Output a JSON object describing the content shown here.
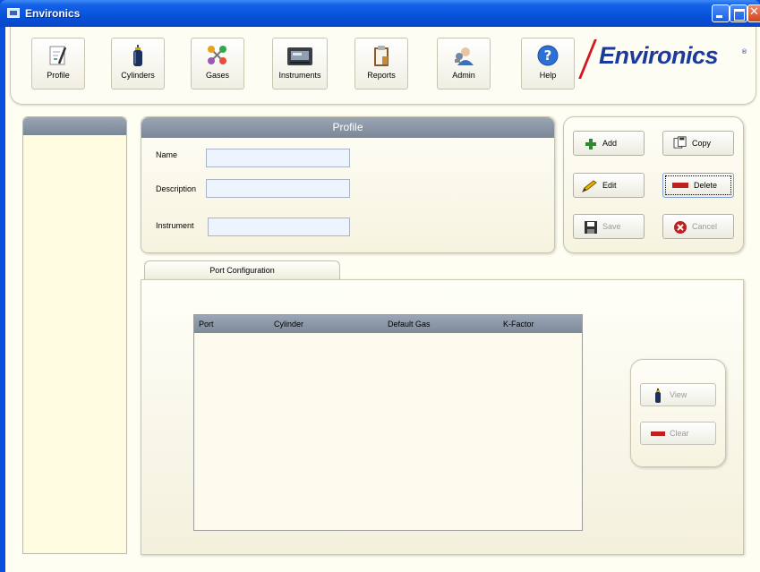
{
  "window": {
    "title": "Environics"
  },
  "toolbar": {
    "buttons": [
      {
        "label": "Profile",
        "icon": "profile-icon"
      },
      {
        "label": "Cylinders",
        "icon": "cylinder-icon"
      },
      {
        "label": "Gases",
        "icon": "gases-icon"
      },
      {
        "label": "Instruments",
        "icon": "instrument-icon"
      },
      {
        "label": "Reports",
        "icon": "reports-icon"
      },
      {
        "label": "Admin",
        "icon": "admin-icon"
      },
      {
        "label": "Help",
        "icon": "help-icon"
      }
    ],
    "logo_text": "Environics",
    "logo_mark": "®"
  },
  "profile": {
    "header": "Profile",
    "fields": {
      "name_label": "Name",
      "name_value": "",
      "description_label": "Description",
      "description_value": "",
      "instrument_label": "Instrument",
      "instrument_value": ""
    }
  },
  "actions": {
    "add": "Add",
    "copy": "Copy",
    "edit": "Edit",
    "delete": "Delete",
    "save": "Save",
    "cancel": "Cancel"
  },
  "port_configuration": {
    "tab_label": "Port Configuration",
    "columns": [
      "Port",
      "Cylinder",
      "Default Gas",
      "K-Factor"
    ],
    "rows": [],
    "view_label": "View",
    "clear_label": "Clear"
  },
  "colors": {
    "titlebar": "#0652d9",
    "panel_header": "#7a8797",
    "background": "#fffef2",
    "logo_blue": "#1c3a9c",
    "logo_red": "#d8141c"
  }
}
